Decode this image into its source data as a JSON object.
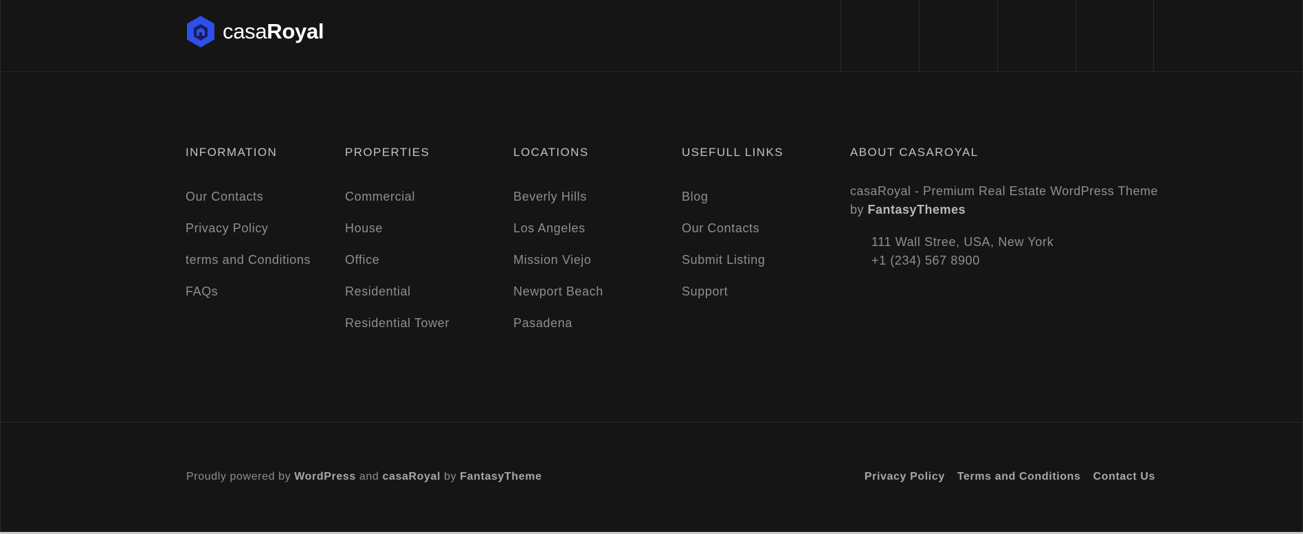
{
  "brand": {
    "name_light": "casa",
    "name_bold": "Royal",
    "accent": "#2f4fe8"
  },
  "columns": [
    {
      "title": "INFORMATION",
      "items": [
        "Our Contacts",
        "Privacy Policy",
        "terms and Conditions",
        "FAQs"
      ]
    },
    {
      "title": "PROPERTIES",
      "items": [
        "Commercial",
        "House",
        "Office",
        "Residential",
        "Residential Tower"
      ]
    },
    {
      "title": "LOCATIONS",
      "items": [
        "Beverly Hills",
        "Los Angeles",
        "Mission Viejo",
        "Newport Beach",
        "Pasadena"
      ]
    },
    {
      "title": "USEFULL LINKS",
      "items": [
        "Blog",
        "Our Contacts",
        "Submit Listing",
        "Support"
      ]
    }
  ],
  "about": {
    "title": "ABOUT CASAROYAL",
    "text": "casaRoyal - Premium Real Estate WordPress Theme by",
    "text_bold": "FantasyThemes",
    "address": "111 Wall Stree, USA, New York",
    "phone": "+1 (234) 567 8900"
  },
  "footer": {
    "p1": "Proudly powered by",
    "wp": "WordPress",
    "and": "and",
    "brand": "casaRoyal",
    "by": "by",
    "theme": "FantasyTheme",
    "links": [
      "Privacy Policy",
      "Terms and Conditions",
      "Contact Us"
    ]
  }
}
